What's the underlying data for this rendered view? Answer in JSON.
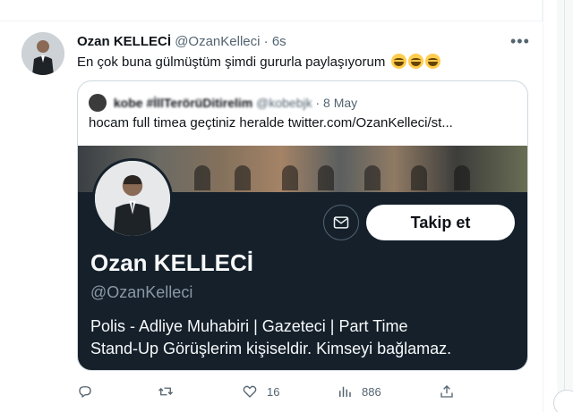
{
  "tweet": {
    "author_name": "Ozan KELLECİ",
    "author_handle": "@OzanKelleci",
    "separator": "·",
    "time": "6s",
    "text": "En çok buna gülmüştüm şimdi gururla paylaşıyorum",
    "emojis": [
      "joy-emoji",
      "joy-emoji",
      "joy-emoji"
    ]
  },
  "quote": {
    "author_name": "kobe #İllTerörüDitirelim",
    "author_handle": "@kobebjk",
    "separator": "·",
    "date": "8 May",
    "text": "hocam full timea geçtiniz heralde  twitter.com/OzanKelleci/st..."
  },
  "profile_card": {
    "name": "Ozan KELLECİ",
    "handle": "@OzanKelleci",
    "follow_label": "Takip et",
    "bio_line_1": "Polis - Adliye Muhabiri | Gazeteci | Part Time",
    "bio_line_2": "Stand-Up  Görüşlerim kişiseldir. Kimseyi bağlamaz."
  },
  "actions": {
    "reply_count": "",
    "retweet_count": "",
    "like_count": "16",
    "view_count": "886"
  },
  "icons": [
    "more-icon",
    "reply-icon",
    "retweet-icon",
    "like-icon",
    "views-icon",
    "share-icon",
    "mail-icon"
  ],
  "colors": {
    "text_primary": "#0f1419",
    "text_secondary": "#536471",
    "card_background": "#15202b",
    "border": "#cfd9de"
  }
}
